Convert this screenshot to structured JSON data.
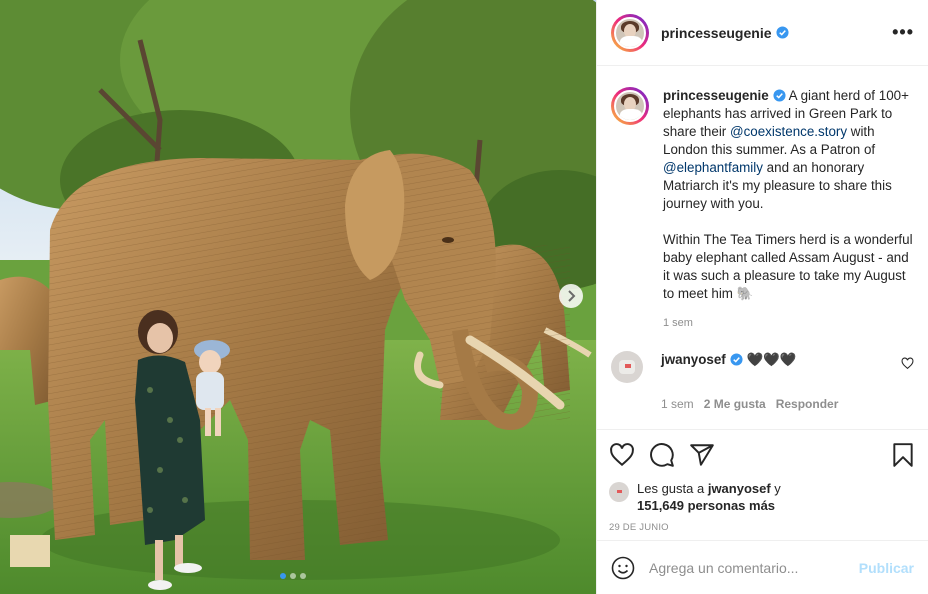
{
  "post": {
    "image_alt_icon": "photo-carousel",
    "carousel_dots": 3,
    "active_dot": 0
  },
  "header": {
    "username": "princesseugenie",
    "verified_icon": "verified-badge-icon",
    "more_icon": "•••"
  },
  "caption": {
    "username": "princesseugenie",
    "text_1": " A giant herd of 100+ elephants has arrived in Green Park to share their ",
    "mention_1": "@coexistence.story",
    "text_2": " with London this summer. As a Patron of ",
    "mention_2": "@elephantfamily",
    "text_3": " and an honorary Matriarch it's my pleasure to share this journey with you.",
    "paragraph_2": "Within The Tea Timers herd is a wonderful baby elephant called Assam August - and it was such a pleasure to take my August to meet him 🐘",
    "time": "1 sem"
  },
  "reply": {
    "username": "jwanyosef",
    "text": "🖤🖤🖤",
    "time": "1 sem",
    "likes": "2 Me gusta",
    "reply_label": "Responder"
  },
  "likes": {
    "prefix": "Les gusta a ",
    "user": "jwanyosef",
    "middle": " y",
    "count": "151,649 personas más"
  },
  "date": "29 DE JUNIO",
  "comment_box": {
    "placeholder": "Agrega un comentario...",
    "publish": "Publicar"
  },
  "colors": {
    "link": "#00376b",
    "verified": "#3897f0",
    "publish_disabled": "#b2dffc",
    "muted": "#8e8e8e"
  }
}
